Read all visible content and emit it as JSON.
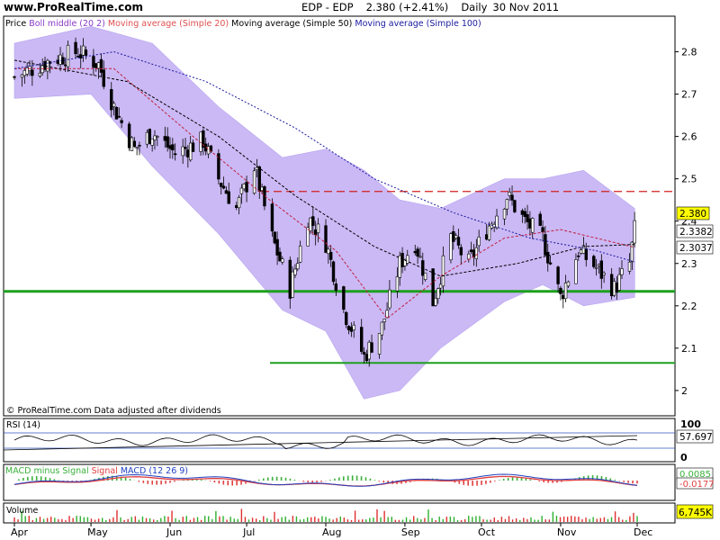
{
  "header": {
    "site": "www.ProRealTime.com",
    "title": "EDP - EDP",
    "price_change": "2.380 (+2.41%)",
    "period": "Daily",
    "date": "30 Nov 2011"
  },
  "price_panel": {
    "legend": [
      {
        "text": "Price",
        "color": "#000000"
      },
      {
        "text": "Boll middle (20 2)",
        "color": "#8b3ac8"
      },
      {
        "text": "Moving average (Simple 20)",
        "color": "#e05050"
      },
      {
        "text": "Moving average (Simple 50)",
        "color": "#000000"
      },
      {
        "text": "Moving average (Simple 100)",
        "color": "#1a1aa0"
      }
    ],
    "footer": "© ProRealTime.com  Data adjusted after dividends",
    "last_price_label": "2.380",
    "ma20_label": "2.3382",
    "ma100_label": "2.3037"
  },
  "rsi_panel": {
    "label": "RSI (14)",
    "top_tick": "100",
    "bottom_tick": "0",
    "value_label": "57.697"
  },
  "macd_panel": {
    "label_parts": [
      {
        "text": "MACD minus Signal",
        "color": "#3ab03a"
      },
      {
        "text": "Signal",
        "color": "#e04040"
      },
      {
        "text": "MACD (12 26 9)",
        "color": "#2040c0"
      }
    ],
    "value_labels": [
      "0.0085",
      "-0.0177"
    ]
  },
  "volume_panel": {
    "label": "Volume",
    "value_label": "6,745K"
  },
  "chart_data": {
    "type": "candlestick",
    "title": "EDP - EDP",
    "x_ticks": [
      "Apr",
      "May",
      "Jun",
      "Jul",
      "Aug",
      "Sep",
      "Oct",
      "Nov",
      "Dec"
    ],
    "x_range": [
      "2011-04-01",
      "2011-12-01"
    ],
    "y_ticks": [
      2,
      2.1,
      2.2,
      2.3,
      2.4,
      2.5,
      2.6,
      2.7,
      2.8
    ],
    "ylim": [
      1.97,
      2.85
    ],
    "horizontal_lines": [
      {
        "value": 2.47,
        "color": "#d42020",
        "style": "dashed"
      },
      {
        "value": 2.234,
        "color": "#1da01d",
        "style": "solid"
      },
      {
        "value": 2.065,
        "color": "#1da01d",
        "style": "solid"
      }
    ],
    "close_series": [
      {
        "date": "2011-04-01",
        "value": 2.74
      },
      {
        "date": "2011-04-15",
        "value": 2.78
      },
      {
        "date": "2011-04-26",
        "value": 2.8
      },
      {
        "date": "2011-05-04",
        "value": 2.77
      },
      {
        "date": "2011-05-10",
        "value": 2.67
      },
      {
        "date": "2011-05-18",
        "value": 2.57
      },
      {
        "date": "2011-05-25",
        "value": 2.61
      },
      {
        "date": "2011-06-03",
        "value": 2.56
      },
      {
        "date": "2011-06-14",
        "value": 2.59
      },
      {
        "date": "2011-06-20",
        "value": 2.5
      },
      {
        "date": "2011-06-27",
        "value": 2.43
      },
      {
        "date": "2011-07-04",
        "value": 2.53
      },
      {
        "date": "2011-07-11",
        "value": 2.36
      },
      {
        "date": "2011-07-18",
        "value": 2.24
      },
      {
        "date": "2011-07-25",
        "value": 2.41
      },
      {
        "date": "2011-08-01",
        "value": 2.35
      },
      {
        "date": "2011-08-08",
        "value": 2.19
      },
      {
        "date": "2011-08-16",
        "value": 2.08
      },
      {
        "date": "2011-08-23",
        "value": 2.15
      },
      {
        "date": "2011-08-30",
        "value": 2.3
      },
      {
        "date": "2011-09-05",
        "value": 2.35
      },
      {
        "date": "2011-09-12",
        "value": 2.21
      },
      {
        "date": "2011-09-19",
        "value": 2.36
      },
      {
        "date": "2011-09-26",
        "value": 2.3
      },
      {
        "date": "2011-10-03",
        "value": 2.38
      },
      {
        "date": "2011-10-11",
        "value": 2.46
      },
      {
        "date": "2011-10-18",
        "value": 2.4
      },
      {
        "date": "2011-10-25",
        "value": 2.36
      },
      {
        "date": "2011-11-01",
        "value": 2.22
      },
      {
        "date": "2011-11-08",
        "value": 2.33
      },
      {
        "date": "2011-11-15",
        "value": 2.29
      },
      {
        "date": "2011-11-22",
        "value": 2.24
      },
      {
        "date": "2011-11-28",
        "value": 2.3
      },
      {
        "date": "2011-11-30",
        "value": 2.38
      }
    ],
    "bollinger_band_upper": [
      {
        "date": "2011-04-01",
        "value": 2.82
      },
      {
        "date": "2011-05-01",
        "value": 2.86
      },
      {
        "date": "2011-05-25",
        "value": 2.82
      },
      {
        "date": "2011-06-20",
        "value": 2.67
      },
      {
        "date": "2011-07-15",
        "value": 2.55
      },
      {
        "date": "2011-08-01",
        "value": 2.57
      },
      {
        "date": "2011-08-16",
        "value": 2.52
      },
      {
        "date": "2011-08-30",
        "value": 2.45
      },
      {
        "date": "2011-09-15",
        "value": 2.43
      },
      {
        "date": "2011-10-10",
        "value": 2.5
      },
      {
        "date": "2011-10-25",
        "value": 2.5
      },
      {
        "date": "2011-11-10",
        "value": 2.52
      },
      {
        "date": "2011-11-30",
        "value": 2.43
      }
    ],
    "bollinger_band_lower": [
      {
        "date": "2011-04-01",
        "value": 2.69
      },
      {
        "date": "2011-05-01",
        "value": 2.7
      },
      {
        "date": "2011-05-25",
        "value": 2.53
      },
      {
        "date": "2011-06-20",
        "value": 2.37
      },
      {
        "date": "2011-07-15",
        "value": 2.19
      },
      {
        "date": "2011-08-01",
        "value": 2.14
      },
      {
        "date": "2011-08-16",
        "value": 1.98
      },
      {
        "date": "2011-08-30",
        "value": 2.0
      },
      {
        "date": "2011-09-15",
        "value": 2.1
      },
      {
        "date": "2011-10-10",
        "value": 2.21
      },
      {
        "date": "2011-10-25",
        "value": 2.25
      },
      {
        "date": "2011-11-10",
        "value": 2.2
      },
      {
        "date": "2011-11-30",
        "value": 2.22
      }
    ],
    "ma20": [
      {
        "date": "2011-04-01",
        "value": 2.76
      },
      {
        "date": "2011-05-10",
        "value": 2.76
      },
      {
        "date": "2011-06-10",
        "value": 2.6
      },
      {
        "date": "2011-07-10",
        "value": 2.45
      },
      {
        "date": "2011-08-05",
        "value": 2.33
      },
      {
        "date": "2011-08-25",
        "value": 2.17
      },
      {
        "date": "2011-09-15",
        "value": 2.27
      },
      {
        "date": "2011-10-10",
        "value": 2.36
      },
      {
        "date": "2011-11-01",
        "value": 2.38
      },
      {
        "date": "2011-11-30",
        "value": 2.3382
      }
    ],
    "ma50": [
      {
        "date": "2011-04-01",
        "value": 2.78
      },
      {
        "date": "2011-05-15",
        "value": 2.73
      },
      {
        "date": "2011-06-20",
        "value": 2.6
      },
      {
        "date": "2011-07-20",
        "value": 2.46
      },
      {
        "date": "2011-08-20",
        "value": 2.34
      },
      {
        "date": "2011-09-15",
        "value": 2.27
      },
      {
        "date": "2011-10-15",
        "value": 2.3
      },
      {
        "date": "2011-11-10",
        "value": 2.34
      },
      {
        "date": "2011-11-30",
        "value": 2.345
      }
    ],
    "ma100": [
      {
        "date": "2011-04-01",
        "value": 2.76
      },
      {
        "date": "2011-05-10",
        "value": 2.8
      },
      {
        "date": "2011-06-15",
        "value": 2.73
      },
      {
        "date": "2011-07-20",
        "value": 2.62
      },
      {
        "date": "2011-08-20",
        "value": 2.5
      },
      {
        "date": "2011-09-20",
        "value": 2.42
      },
      {
        "date": "2011-10-20",
        "value": 2.36
      },
      {
        "date": "2011-11-15",
        "value": 2.33
      },
      {
        "date": "2011-11-30",
        "value": 2.3037
      }
    ],
    "rsi": {
      "ylim": [
        0,
        100
      ],
      "last": 57.697
    },
    "macd": {
      "last_macd": 0.0085,
      "last_signal": -0.0177
    },
    "volume": {
      "last": "6,745K"
    }
  },
  "colors": {
    "band_fill": "#c9b6f5",
    "band_edge": "#b19df0",
    "panel_border": "#000000",
    "last_price_bg": "#ffff00",
    "ma20": "#c02040",
    "ma50": "#000000",
    "ma100": "#1a1aa0",
    "macd_signal": "#e04040",
    "macd_line": "#2040c0",
    "macd_hist": "#3ab03a",
    "vol_up": "#2fb02f",
    "vol_down": "#e03030"
  }
}
